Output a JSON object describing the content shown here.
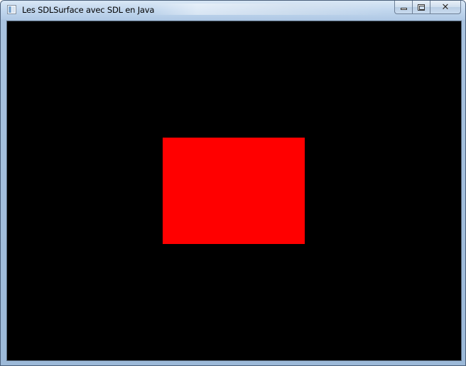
{
  "window": {
    "title": "Les SDLSurface avec SDL en Java",
    "icon": "app-window-icon"
  },
  "caption_buttons": {
    "minimize_icon": "minimize-icon",
    "maximize_icon": "maximize-icon",
    "close_icon": "close-icon",
    "close_glyph": "✕"
  },
  "canvas": {
    "background_color": "#000000",
    "surface": {
      "shape": "rectangle",
      "color": "#ff0000"
    }
  }
}
